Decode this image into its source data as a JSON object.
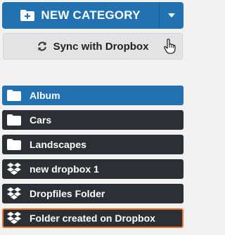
{
  "header": {
    "new_category_label": "NEW CATEGORY",
    "sync_label": "Sync with Dropbox"
  },
  "folders": [
    {
      "label": "Album",
      "icon": "folder-icon",
      "state": "active"
    },
    {
      "label": "Cars",
      "icon": "folder-icon",
      "state": "normal"
    },
    {
      "label": "Landscapes",
      "icon": "folder-icon",
      "state": "normal"
    },
    {
      "label": "new dropbox 1",
      "icon": "dropbox-icon",
      "state": "normal"
    },
    {
      "label": "Dropfiles Folder",
      "icon": "dropbox-icon",
      "state": "normal"
    },
    {
      "label": "Folder created on Dropbox",
      "icon": "dropbox-icon",
      "state": "highlighted"
    }
  ],
  "colors": {
    "primary": "#2271b1",
    "folder_bg": "#2c2f33",
    "highlight_border": "#e8772e",
    "sync_bg": "#e3e3e3"
  }
}
